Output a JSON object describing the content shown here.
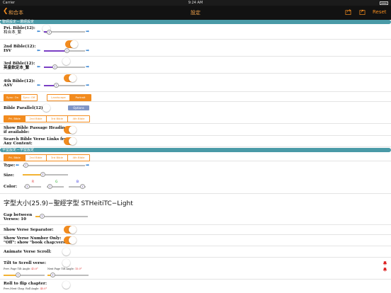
{
  "status_bar": {
    "carrier": "Carrier",
    "time": "9:24 AM"
  },
  "nav": {
    "back_label": "和合本",
    "title": "設定",
    "reset_label": "Reset"
  },
  "sections": {
    "bible_settings": "聖經設定－選經設定",
    "font_settings": "字型設定－字型設定"
  },
  "bibles": [
    {
      "label": "Pri. Bible(12):",
      "sub": "和合本_繁"
    },
    {
      "label": "2nd Bible(12):",
      "sub": "ISV"
    },
    {
      "label": "3rd Bible(12):",
      "sub": "英皇欽定本_繁"
    },
    {
      "label": "4th Bible(12):",
      "sub": "ASV"
    }
  ],
  "sync_segment": [
    "Sync: On",
    "Sync: Off"
  ],
  "orientation_segment": [
    "Landscape",
    "Portrait"
  ],
  "bible_parallel": {
    "label": "Bible Parallel(12):",
    "options_button": "Options"
  },
  "bible_select_segment": [
    "Pri. Bible",
    "2nd Bible",
    "3rd Bible",
    "4th Bible"
  ],
  "passage_headings": {
    "line1": "Show Bible Passage Headings",
    "line2": "if available:"
  },
  "verse_links": {
    "line1": "Search Bible Verse Links from",
    "line2": "Any Content:"
  },
  "font_select_segment": [
    "Pri. Bible",
    "2nd Bible",
    "3rd Bible",
    "4th Bible"
  ],
  "type_label": "Type:",
  "size_label": "Size:",
  "color": {
    "label": "Color:",
    "r": "R",
    "g": "G",
    "b": "B"
  },
  "font_preview": "字型大小(25.9)−聖經字型 STHeitiTC−Light",
  "gap": {
    "line1": "Gap between",
    "line2": "Verses: 10"
  },
  "show_separator": "Show Verse Separator:",
  "verse_number": {
    "line1": "Show Verse Number Only:",
    "line2": "\"Off\": show \"book chap:verse\""
  },
  "animate_scroll": "Animate Verse Scroll:",
  "tilt_scroll": {
    "label": "Tilt to Scroll verse:",
    "prev_label": "Prev. Page Tilt Angle:",
    "prev_value": "45.0°",
    "next_label": "Next Page Tilt Angle:",
    "next_value": "15.0°"
  },
  "roll_flip": {
    "label": "Roll to flip chapter:",
    "prev_label": "Prev./Next Chap. Roll Angle:",
    "prev_value": "45.0°"
  },
  "slider_glyph": "T",
  "icons": [
    "chevron-left-icon",
    "share-icon",
    "export-icon",
    "pin-icon"
  ],
  "colors": {
    "accent": "#f28b1e",
    "section": "#4a9aa7",
    "arrow": "#2e7fd0",
    "slider_purple": "#7a3fc4",
    "slider_orange": "#f2b233"
  },
  "toggles": {
    "pri_bible": false,
    "second_bible": true,
    "third_bible": false,
    "fourth_bible": true,
    "bible_parallel": false,
    "passage_headings": true,
    "verse_links": true,
    "verse_separator": true,
    "verse_number": true,
    "animate_scroll": false,
    "tilt_scroll": false,
    "roll_flip": false
  }
}
